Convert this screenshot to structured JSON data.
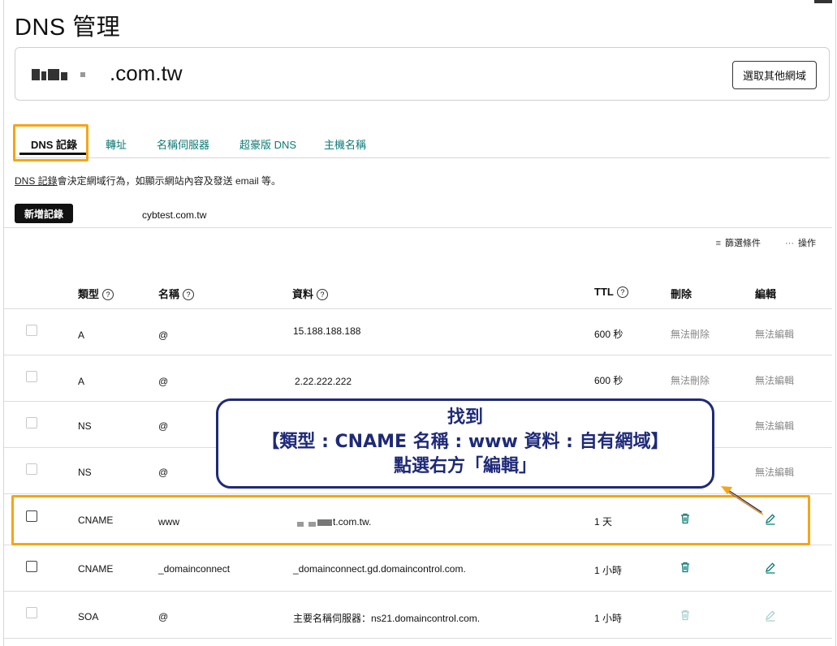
{
  "page": {
    "title": "DNS 管理"
  },
  "domain": {
    "name_suffix": ".com.tw",
    "choose_button": "選取其他網域"
  },
  "tabs": [
    {
      "label": "DNS 記錄",
      "active": true
    },
    {
      "label": "轉址"
    },
    {
      "label": "名稱伺服器"
    },
    {
      "label": "超豪版 DNS"
    },
    {
      "label": "主機名稱"
    }
  ],
  "description": {
    "link": "DNS 記錄",
    "text": "會決定網域行為，如顯示網站內容及發送 email 等。"
  },
  "actions": {
    "add_record": "新增記錄",
    "subdomain": "cybtest.com.tw",
    "filter": "篩選條件",
    "operations": "操作"
  },
  "table": {
    "headers": {
      "type": "類型",
      "name": "名稱",
      "data": "資料",
      "ttl": "TTL",
      "delete": "刪除",
      "edit": "編輯"
    },
    "rows": [
      {
        "type": "A",
        "name": "@",
        "data": "15.188.188.188",
        "ttl": "600 秒",
        "delete": "無法刪除",
        "edit": "無法編輯"
      },
      {
        "type": "A",
        "name": "@",
        "data": "2.22.222.222",
        "ttl": "600 秒",
        "delete": "無法刪除",
        "edit": "無法編輯"
      },
      {
        "type": "NS",
        "name": "@",
        "data": "",
        "ttl": "",
        "delete": "",
        "edit": "無法編輯"
      },
      {
        "type": "NS",
        "name": "@",
        "data": "",
        "ttl": "",
        "delete": "",
        "edit": "無法編輯"
      },
      {
        "type": "CNAME",
        "name": "www",
        "data": "t.com.tw.",
        "ttl": "1 天",
        "delete_icon": "trash-icon",
        "edit_icon": "pencil-icon"
      },
      {
        "type": "CNAME",
        "name": "_domainconnect",
        "data": "_domainconnect.gd.domaincontrol.com.",
        "ttl": "1 小時",
        "delete_icon": "trash-icon",
        "edit_icon": "pencil-icon"
      },
      {
        "type": "SOA",
        "name": "@",
        "data": "主要名稱伺服器：ns21.domaincontrol.com.",
        "ttl": "1 小時",
        "delete_icon": "trash-icon",
        "edit_icon": "pencil-icon"
      }
    ]
  },
  "callout": {
    "line1": "找到",
    "line2": "【類型 : CNAME 名稱 : www 資料 : 自有網域】",
    "line3": "點選右方「編輯」"
  },
  "colors": {
    "accent": "#0b7a75",
    "highlight": "#f5a516",
    "callout": "#1e2a78"
  }
}
